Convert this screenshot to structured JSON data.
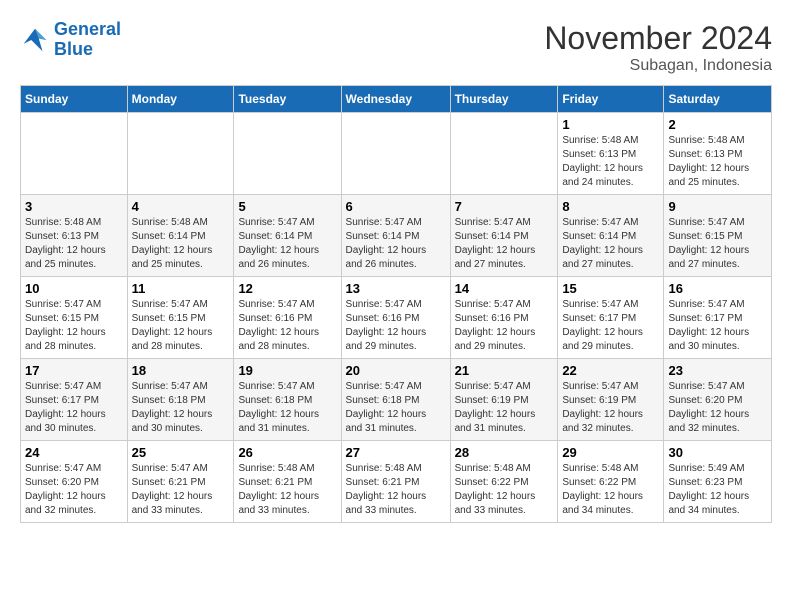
{
  "logo": {
    "line1": "General",
    "line2": "Blue"
  },
  "title": "November 2024",
  "subtitle": "Subagan, Indonesia",
  "days_of_week": [
    "Sunday",
    "Monday",
    "Tuesday",
    "Wednesday",
    "Thursday",
    "Friday",
    "Saturday"
  ],
  "weeks": [
    [
      {
        "day": "",
        "info": ""
      },
      {
        "day": "",
        "info": ""
      },
      {
        "day": "",
        "info": ""
      },
      {
        "day": "",
        "info": ""
      },
      {
        "day": "",
        "info": ""
      },
      {
        "day": "1",
        "info": "Sunrise: 5:48 AM\nSunset: 6:13 PM\nDaylight: 12 hours\nand 24 minutes."
      },
      {
        "day": "2",
        "info": "Sunrise: 5:48 AM\nSunset: 6:13 PM\nDaylight: 12 hours\nand 25 minutes."
      }
    ],
    [
      {
        "day": "3",
        "info": "Sunrise: 5:48 AM\nSunset: 6:13 PM\nDaylight: 12 hours\nand 25 minutes."
      },
      {
        "day": "4",
        "info": "Sunrise: 5:48 AM\nSunset: 6:14 PM\nDaylight: 12 hours\nand 25 minutes."
      },
      {
        "day": "5",
        "info": "Sunrise: 5:47 AM\nSunset: 6:14 PM\nDaylight: 12 hours\nand 26 minutes."
      },
      {
        "day": "6",
        "info": "Sunrise: 5:47 AM\nSunset: 6:14 PM\nDaylight: 12 hours\nand 26 minutes."
      },
      {
        "day": "7",
        "info": "Sunrise: 5:47 AM\nSunset: 6:14 PM\nDaylight: 12 hours\nand 27 minutes."
      },
      {
        "day": "8",
        "info": "Sunrise: 5:47 AM\nSunset: 6:14 PM\nDaylight: 12 hours\nand 27 minutes."
      },
      {
        "day": "9",
        "info": "Sunrise: 5:47 AM\nSunset: 6:15 PM\nDaylight: 12 hours\nand 27 minutes."
      }
    ],
    [
      {
        "day": "10",
        "info": "Sunrise: 5:47 AM\nSunset: 6:15 PM\nDaylight: 12 hours\nand 28 minutes."
      },
      {
        "day": "11",
        "info": "Sunrise: 5:47 AM\nSunset: 6:15 PM\nDaylight: 12 hours\nand 28 minutes."
      },
      {
        "day": "12",
        "info": "Sunrise: 5:47 AM\nSunset: 6:16 PM\nDaylight: 12 hours\nand 28 minutes."
      },
      {
        "day": "13",
        "info": "Sunrise: 5:47 AM\nSunset: 6:16 PM\nDaylight: 12 hours\nand 29 minutes."
      },
      {
        "day": "14",
        "info": "Sunrise: 5:47 AM\nSunset: 6:16 PM\nDaylight: 12 hours\nand 29 minutes."
      },
      {
        "day": "15",
        "info": "Sunrise: 5:47 AM\nSunset: 6:17 PM\nDaylight: 12 hours\nand 29 minutes."
      },
      {
        "day": "16",
        "info": "Sunrise: 5:47 AM\nSunset: 6:17 PM\nDaylight: 12 hours\nand 30 minutes."
      }
    ],
    [
      {
        "day": "17",
        "info": "Sunrise: 5:47 AM\nSunset: 6:17 PM\nDaylight: 12 hours\nand 30 minutes."
      },
      {
        "day": "18",
        "info": "Sunrise: 5:47 AM\nSunset: 6:18 PM\nDaylight: 12 hours\nand 30 minutes."
      },
      {
        "day": "19",
        "info": "Sunrise: 5:47 AM\nSunset: 6:18 PM\nDaylight: 12 hours\nand 31 minutes."
      },
      {
        "day": "20",
        "info": "Sunrise: 5:47 AM\nSunset: 6:18 PM\nDaylight: 12 hours\nand 31 minutes."
      },
      {
        "day": "21",
        "info": "Sunrise: 5:47 AM\nSunset: 6:19 PM\nDaylight: 12 hours\nand 31 minutes."
      },
      {
        "day": "22",
        "info": "Sunrise: 5:47 AM\nSunset: 6:19 PM\nDaylight: 12 hours\nand 32 minutes."
      },
      {
        "day": "23",
        "info": "Sunrise: 5:47 AM\nSunset: 6:20 PM\nDaylight: 12 hours\nand 32 minutes."
      }
    ],
    [
      {
        "day": "24",
        "info": "Sunrise: 5:47 AM\nSunset: 6:20 PM\nDaylight: 12 hours\nand 32 minutes."
      },
      {
        "day": "25",
        "info": "Sunrise: 5:47 AM\nSunset: 6:21 PM\nDaylight: 12 hours\nand 33 minutes."
      },
      {
        "day": "26",
        "info": "Sunrise: 5:48 AM\nSunset: 6:21 PM\nDaylight: 12 hours\nand 33 minutes."
      },
      {
        "day": "27",
        "info": "Sunrise: 5:48 AM\nSunset: 6:21 PM\nDaylight: 12 hours\nand 33 minutes."
      },
      {
        "day": "28",
        "info": "Sunrise: 5:48 AM\nSunset: 6:22 PM\nDaylight: 12 hours\nand 33 minutes."
      },
      {
        "day": "29",
        "info": "Sunrise: 5:48 AM\nSunset: 6:22 PM\nDaylight: 12 hours\nand 34 minutes."
      },
      {
        "day": "30",
        "info": "Sunrise: 5:49 AM\nSunset: 6:23 PM\nDaylight: 12 hours\nand 34 minutes."
      }
    ]
  ]
}
